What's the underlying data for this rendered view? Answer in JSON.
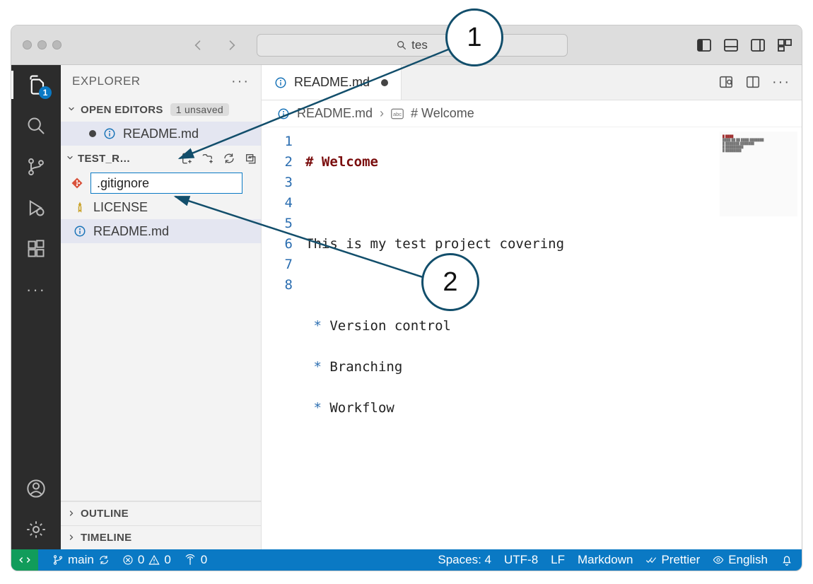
{
  "titlebar": {
    "search_text": "tes"
  },
  "activity": {
    "explorer_badge": "1"
  },
  "sidebar": {
    "title": "EXPLORER",
    "open_editors_label": "OPEN EDITORS",
    "unsaved_badge": "1 unsaved",
    "open_editors": [
      {
        "name": "README.md",
        "modified": true
      }
    ],
    "folder_label": "TEST_R…",
    "new_file_value": ".gitignore",
    "files": [
      {
        "name": "LICENSE",
        "icon": "license"
      },
      {
        "name": "README.md",
        "icon": "info",
        "active": true
      }
    ],
    "outline_label": "OUTLINE",
    "timeline_label": "TIMELINE"
  },
  "tabs": {
    "active": {
      "name": "README.md",
      "modified": true
    }
  },
  "breadcrumb": {
    "file": "README.md",
    "symbol": "# Welcome"
  },
  "code": {
    "line_numbers": [
      "1",
      "2",
      "3",
      "4",
      "5",
      "6",
      "7",
      "8"
    ],
    "lines": [
      {
        "hash": "#",
        "text": "Welcome",
        "type": "h1"
      },
      {
        "text": "",
        "type": "blank"
      },
      {
        "text": "This is my test project covering",
        "type": "text"
      },
      {
        "text": "",
        "type": "blank"
      },
      {
        "star": "*",
        "text": "Version control",
        "type": "li"
      },
      {
        "star": "*",
        "text": "Branching",
        "type": "li"
      },
      {
        "star": "*",
        "text": "Workflow",
        "type": "li"
      },
      {
        "text": "",
        "type": "cursor"
      }
    ]
  },
  "statusbar": {
    "branch": "main",
    "errors": "0",
    "warnings": "0",
    "ports": "0",
    "spaces": "Spaces: 4",
    "encoding": "UTF-8",
    "eol": "LF",
    "language": "Markdown",
    "formatter": "Prettier",
    "spell": "English"
  },
  "callouts": {
    "one": "1",
    "two": "2"
  }
}
